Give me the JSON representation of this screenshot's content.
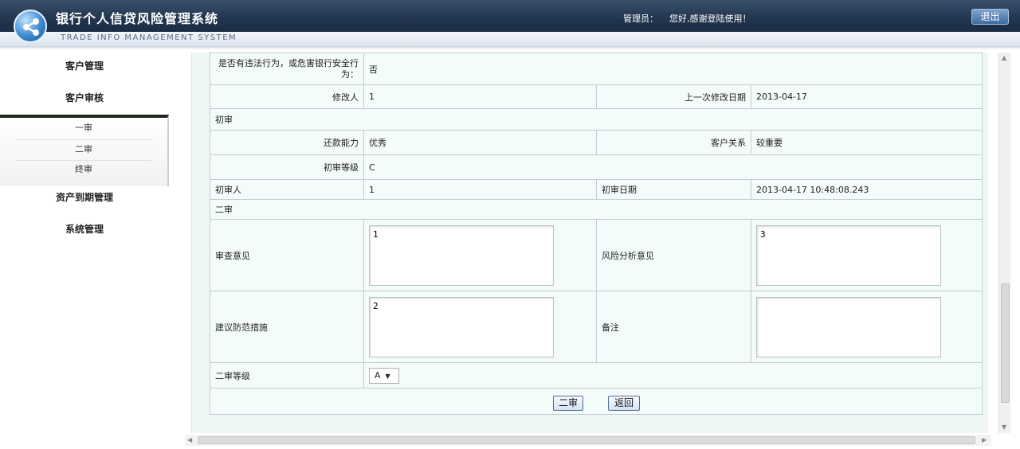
{
  "header": {
    "title": "银行个人信贷风险管理系统",
    "subtitle": "TRADE INFO MANAGEMENT SYSTEM",
    "admin_label": "管理员：",
    "welcome": "您好,感谢登陆使用！",
    "logout": "退出"
  },
  "sidebar": {
    "customer_mgmt": "客户管理",
    "customer_review": "客户审核",
    "sub": [
      "一审",
      "二审",
      "终审"
    ],
    "asset_maturity": "资产到期管理",
    "system_mgmt": "系统管理"
  },
  "form": {
    "illegal_label": "是否有违法行为，或危害银行安全行为：",
    "illegal_value": "否",
    "modifier_label": "修改人",
    "modifier_value": "1",
    "last_mod_label": "上一次修改日期",
    "last_mod_value": "2013-04-17",
    "first_review_section": "初审",
    "repay_label": "还款能力",
    "repay_value": "优秀",
    "relation_label": "客户关系",
    "relation_value": "较重要",
    "grade_label": "初审等级",
    "grade_value": "C",
    "reviewer_label": "初审人",
    "reviewer_value": "1",
    "review_date_label": "初审日期",
    "review_date_value": "2013-04-17 10:48:08.243",
    "second_review_section": "二审",
    "opinion_label": "审查意见",
    "opinion_value": "1",
    "risk_label": "风险分析意见",
    "risk_value": "3",
    "measures_label": "建议防范措施",
    "measures_value": "2",
    "remark_label": "备注",
    "remark_value": "",
    "second_grade_label": "二审等级",
    "second_grade_value": "A",
    "submit_button": "二审",
    "back_button": "返回"
  },
  "colors": {
    "header_bg": "#22354f",
    "panel_bg": "#eef6f6"
  }
}
